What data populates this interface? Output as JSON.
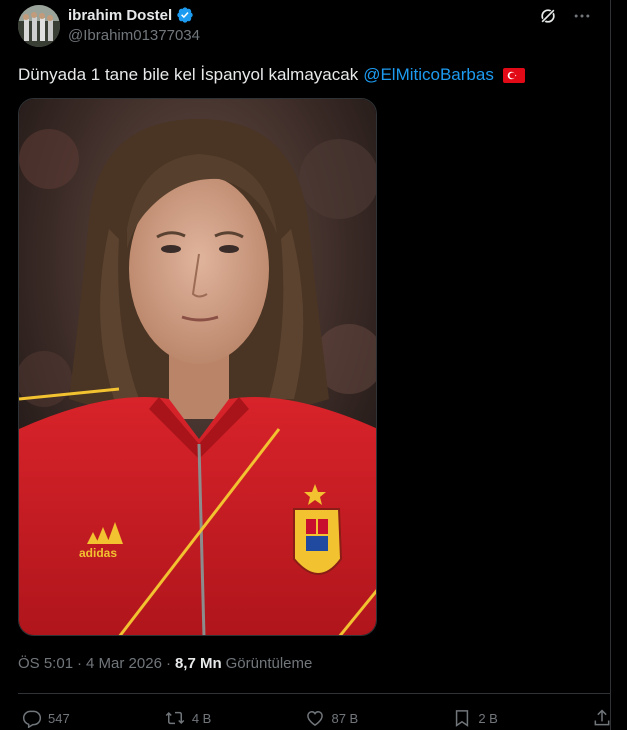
{
  "author": {
    "display_name": "ibrahim Dostel",
    "handle": "@Ibrahim01377034",
    "verified_icon": "verified-badge-icon"
  },
  "tweet": {
    "text": "Dünyada 1 tane bile kel İspanyol kalmayacak",
    "mention": "@ElMiticoBarbas",
    "flag": "turkey-flag-icon"
  },
  "media": {
    "description_icon": "photo-icon"
  },
  "meta": {
    "time": "ÖS 5:01",
    "separator": "·",
    "date": "4 Mar 2026",
    "views_count": "8,7 Mn",
    "views_label": "Görüntüleme"
  },
  "actions": {
    "replies": "547",
    "reposts": "4 B",
    "likes": "87 B",
    "bookmarks": "2 B"
  },
  "colors": {
    "background": "#000000",
    "text": "#e7e9ea",
    "muted": "#71767b",
    "accent": "#1d9bf0",
    "border": "#2f3336"
  }
}
